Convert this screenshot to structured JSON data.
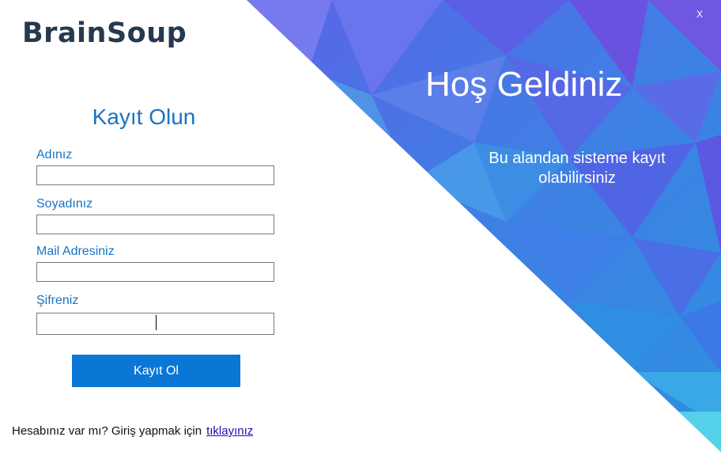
{
  "brand": {
    "logo_text": "BrainSoup"
  },
  "window": {
    "close_label": "X"
  },
  "hero": {
    "title": "Hoş Geldiniz",
    "subtitle": "Bu alandan sisteme kayıt olabilirsiniz",
    "colors": {
      "deep": "#4f5ee4",
      "mid": "#3b7fe6",
      "light": "#46c2e8",
      "accent": "#6a52e0"
    }
  },
  "form": {
    "title": "Kayıt Olun",
    "fields": [
      {
        "label": "Adınız",
        "value": "",
        "placeholder": ""
      },
      {
        "label": "Soyadınız",
        "value": "",
        "placeholder": ""
      },
      {
        "label": "Mail Adresiniz",
        "value": "",
        "placeholder": ""
      },
      {
        "label": "Şifreniz",
        "value": "",
        "placeholder": ""
      }
    ],
    "submit_label": "Kayıt Ol",
    "accent_color": "#0a76d5"
  },
  "footer": {
    "prompt": "Hesabınız var mı? Giriş yapmak için",
    "link_label": "tıklayınız"
  }
}
